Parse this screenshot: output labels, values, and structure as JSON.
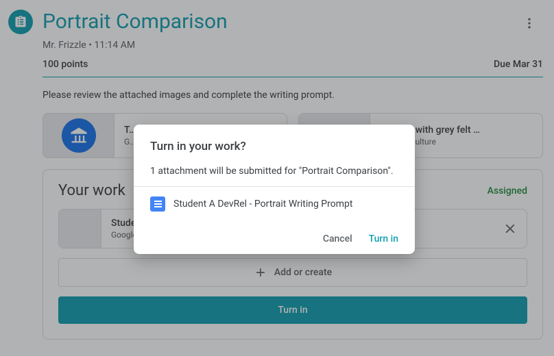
{
  "colors": {
    "accent": "#129eaf",
    "green": "#1e8e3e",
    "blue": "#1a73e8"
  },
  "header": {
    "title": "Portrait Comparison",
    "author": "Mr. Frizzle",
    "time": "11:14 AM",
    "subtitle": "Mr. Frizzle • 11:14 AM"
  },
  "meta": {
    "points": "100 points",
    "due": "Due Mar 31"
  },
  "description": "Please review the attached images and complete the writing prompt.",
  "attachments": [
    {
      "title": "T…",
      "source": "G…",
      "icon": "museum-icon"
    },
    {
      "title": "…ortrait with grey felt …",
      "source": "…Arts & Culture",
      "icon": "museum-icon"
    }
  ],
  "your_work": {
    "heading": "Your work",
    "status": "Assigned",
    "file": {
      "title": "Studen…",
      "subtitle": "Google …"
    },
    "add_label": "Add or create",
    "turn_in_label": "Turn in"
  },
  "dialog": {
    "title": "Turn in your work?",
    "body": "1 attachment will be submitted for \"Portrait Comparison\".",
    "attachment": "Student A DevRel - Portrait Writing Prompt",
    "cancel": "Cancel",
    "confirm": "Turn in"
  }
}
